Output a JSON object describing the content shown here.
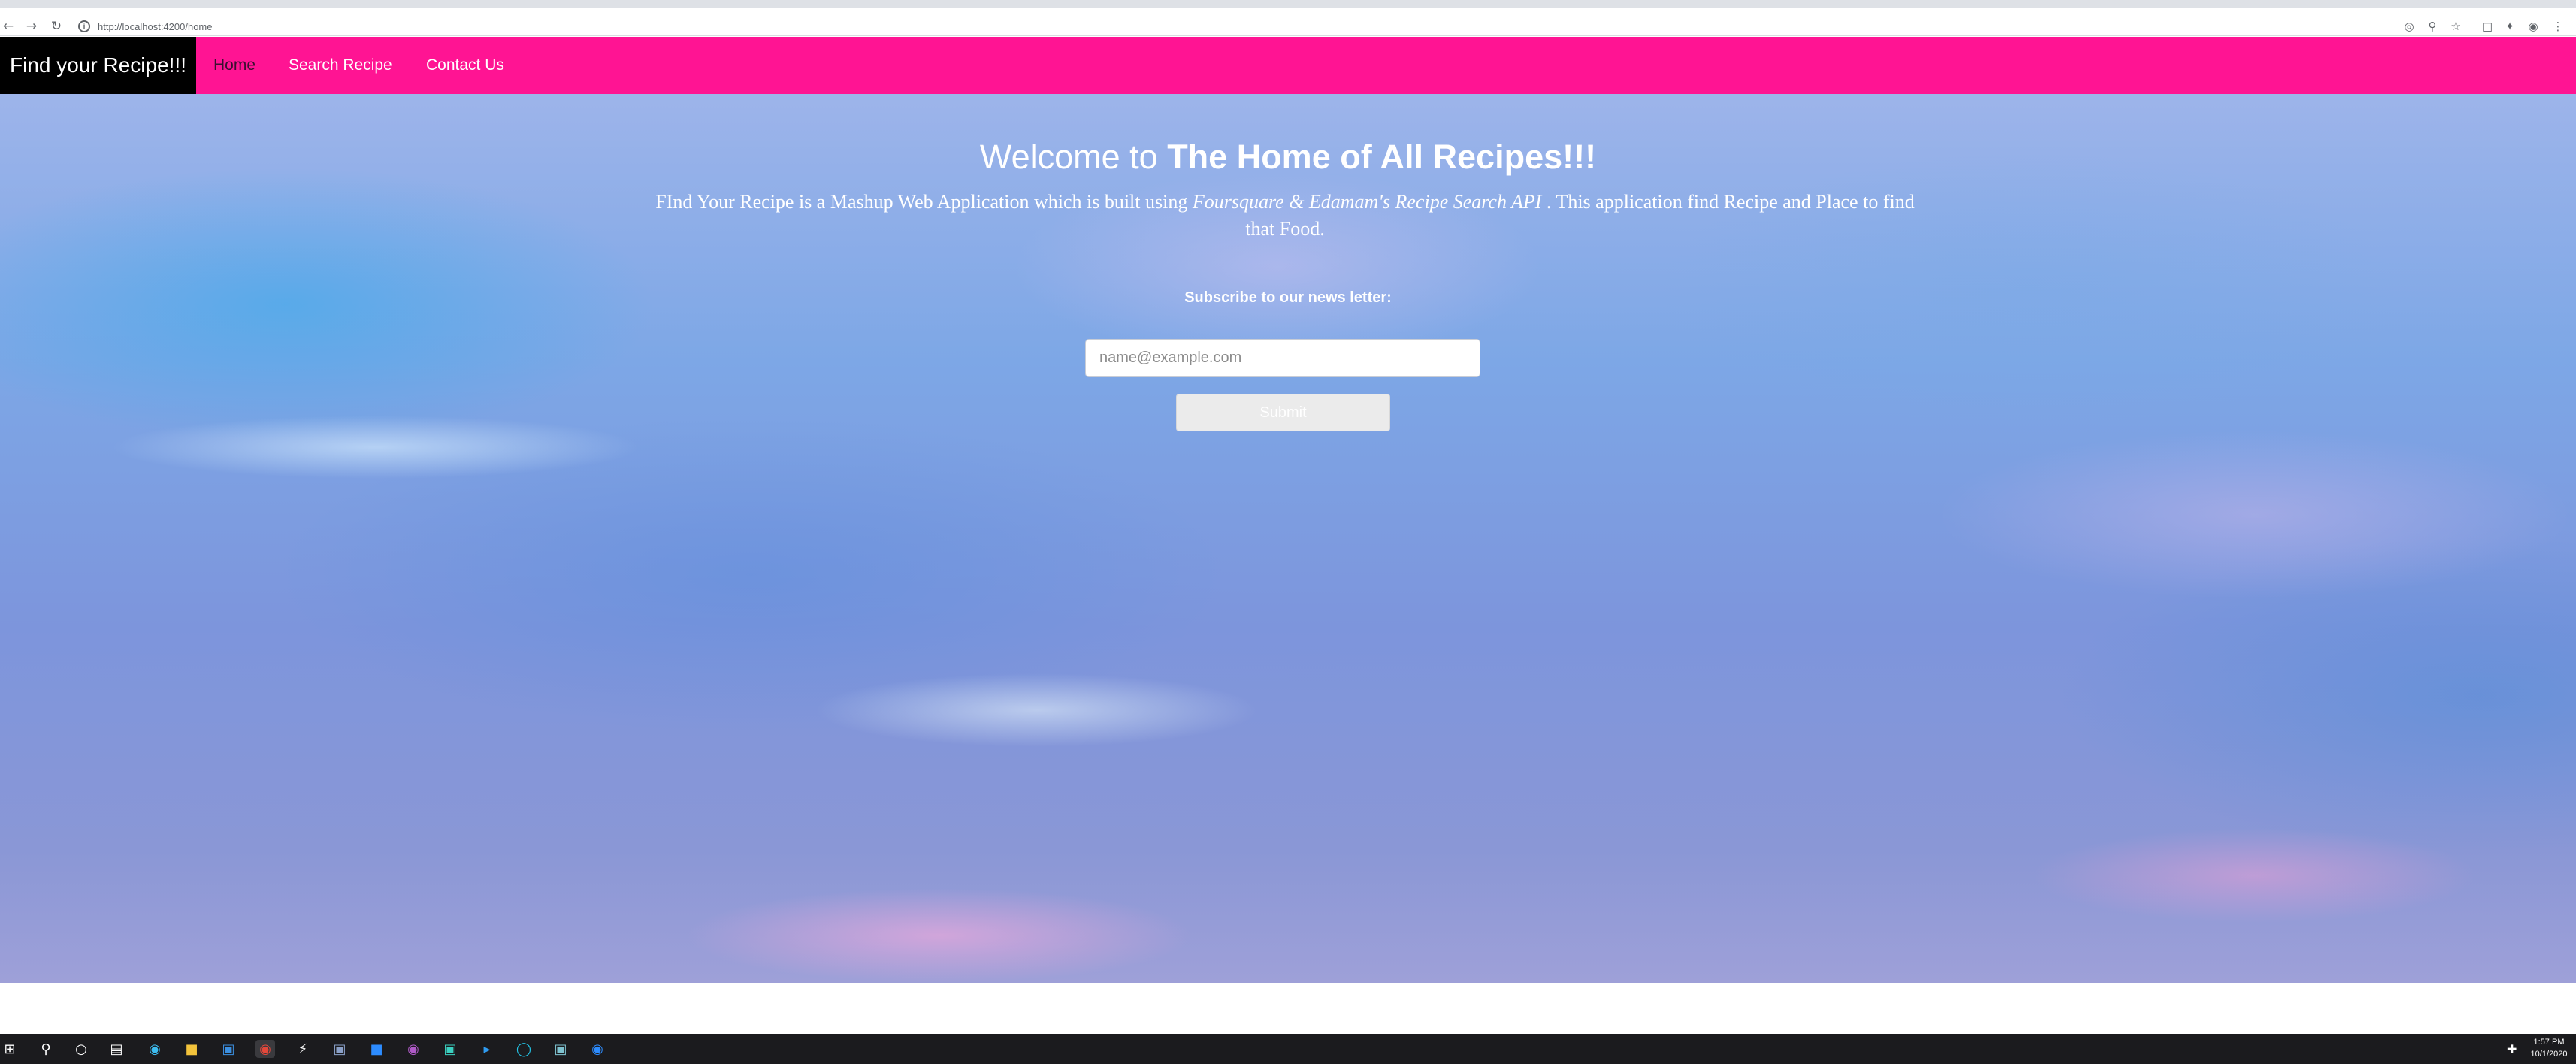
{
  "browser": {
    "url": "http://localhost:4200/home",
    "back_icon": "arrow-left-icon",
    "forward_icon": "arrow-right-icon",
    "reload_icon": "reload-icon"
  },
  "navbar": {
    "brand": "Find your Recipe!!!",
    "links": [
      {
        "label": "Home",
        "active": true
      },
      {
        "label": "Search Recipe",
        "active": false
      },
      {
        "label": "Contact Us",
        "active": false
      }
    ],
    "color": "#ff1493"
  },
  "hero": {
    "title_prefix": "Welcome to",
    "title_bold": "The Home of All Recipes!!!",
    "desc_part1": "FInd Your Recipe is a Mashup Web Application which is built using",
    "desc_italic": "Foursquare & Edamam's Recipe Search API",
    "desc_part2": ". This application find Recipe and Place to find that Food.",
    "subscribe_label": "Subscribe to our news letter:",
    "email_placeholder": "name@example.com",
    "submit_label": "Submit"
  },
  "taskbar": {
    "time": "1:57 PM",
    "date": "10/1/2020"
  }
}
